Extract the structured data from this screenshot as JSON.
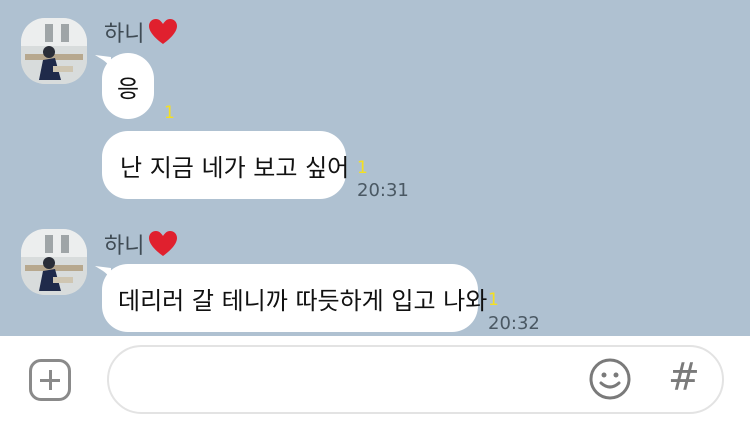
{
  "messages": [
    {
      "sender": "하니",
      "text": "응",
      "unread": "1",
      "time": ""
    },
    {
      "sender": "",
      "text": "난 지금 네가 보고 싶어",
      "unread": "1",
      "time": "20:31"
    },
    {
      "sender": "하니",
      "text": "데리러 갈 테니까 따듯하게 입고 나와",
      "unread": "1",
      "time": "20:32"
    }
  ],
  "icons": {
    "heart": "red-heart-icon",
    "add": "plus-icon",
    "emoji": "smiley-icon",
    "hashtag": "hash-icon"
  },
  "hash_symbol": "#",
  "colors": {
    "chat_bg": "#afc1d1",
    "bubble": "#ffffff",
    "unread": "#f5e020"
  }
}
